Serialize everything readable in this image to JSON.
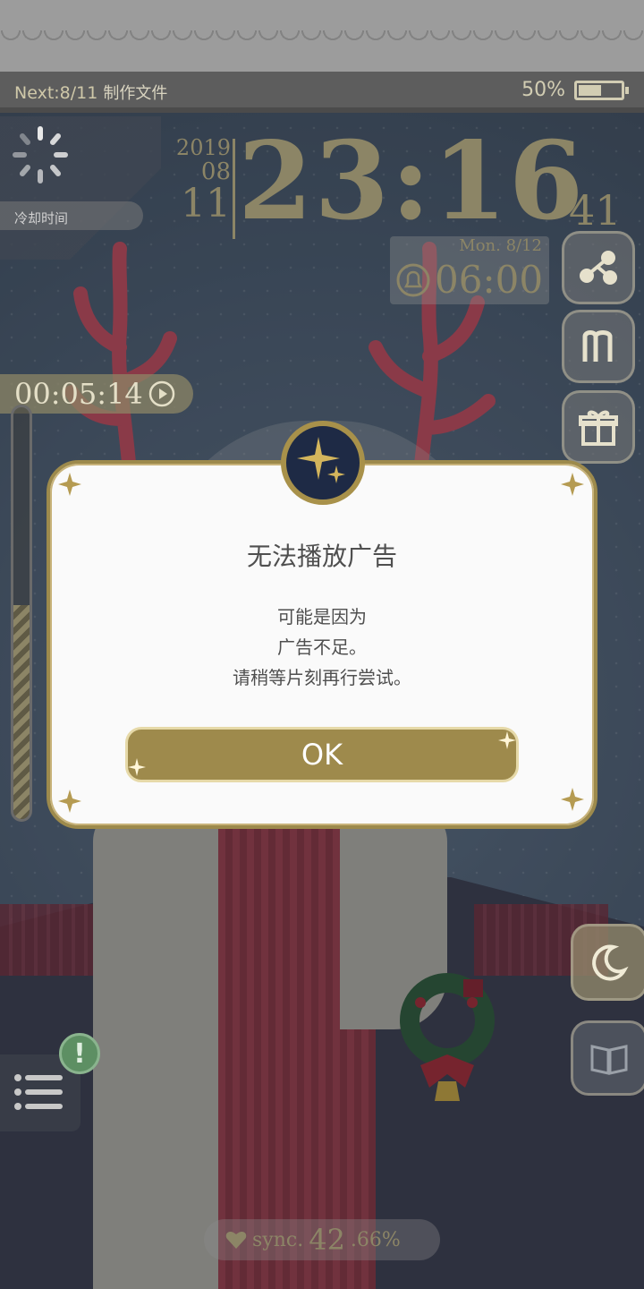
{
  "status_bar": {
    "next_label": "Next:8/11",
    "task_label": "制作文件",
    "battery_percent_label": "50%",
    "battery_level": 0.5
  },
  "cooldown_label": "冷却时间",
  "clock": {
    "year": "2019",
    "month": "08",
    "day": "11",
    "time": "23:16",
    "seconds": "41",
    "alarm_day": "Mon.  8/12",
    "alarm_time": "06:00"
  },
  "timer": {
    "value": "00:05:14"
  },
  "progress": {
    "level": 0.52
  },
  "side_buttons": [
    "share-icon",
    "m-icon",
    "gift-icon",
    "moon-icon",
    "book-icon"
  ],
  "dialog": {
    "title": "无法播放广告",
    "message_lines": [
      "可能是因为",
      "广告不足。",
      "请稍等片刻再行尝试。"
    ],
    "ok_label": "OK"
  },
  "notification": {
    "badge": "!"
  },
  "sync": {
    "label": "sync.",
    "integer": "42",
    "decimal": ".66%"
  },
  "colors": {
    "gold": "#9e8a4c",
    "dialog_bg": "#fafafa",
    "antler": "#c34b5c"
  }
}
